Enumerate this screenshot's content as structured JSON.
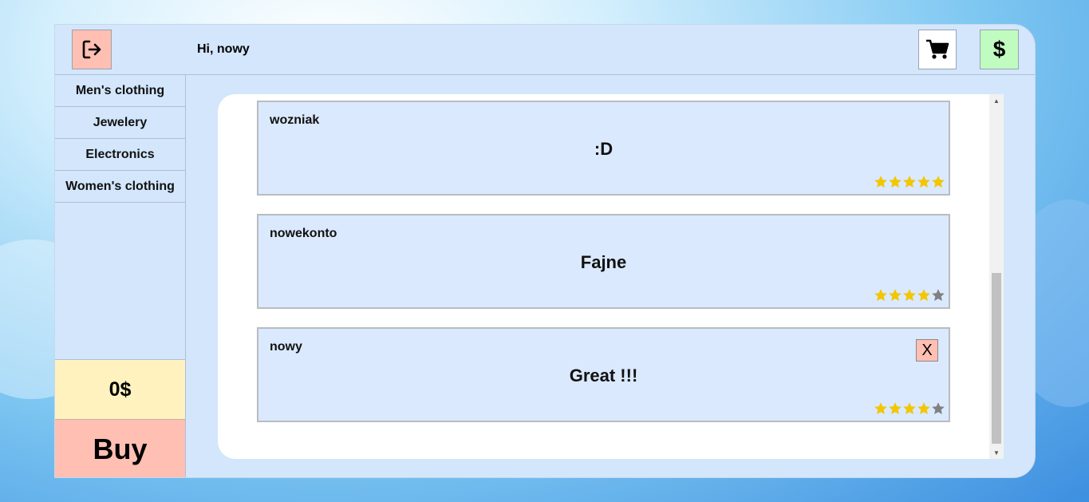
{
  "header": {
    "greeting": "Hi, nowy",
    "logout_icon": "logout-icon",
    "cart_icon": "cart-icon",
    "money_label": "$"
  },
  "sidebar": {
    "categories": [
      {
        "label": "Men's clothing"
      },
      {
        "label": "Jewelery"
      },
      {
        "label": "Electronics"
      },
      {
        "label": "Women's clothing"
      }
    ],
    "balance": "0$",
    "buy_label": "Buy"
  },
  "reviews": [
    {
      "user": "wozniak",
      "text": ":D",
      "rating": 5,
      "deletable": false
    },
    {
      "user": "nowekonto",
      "text": "Fajne",
      "rating": 4,
      "deletable": false
    },
    {
      "user": "nowy",
      "text": "Great !!!",
      "rating": 4,
      "deletable": true,
      "delete_label": "X"
    }
  ],
  "colors": {
    "star_filled": "#f2c600",
    "star_empty": "#808080",
    "accent_red": "#ffbfb3",
    "accent_green": "#c0fbbf",
    "accent_yellow": "#fff2bf"
  }
}
